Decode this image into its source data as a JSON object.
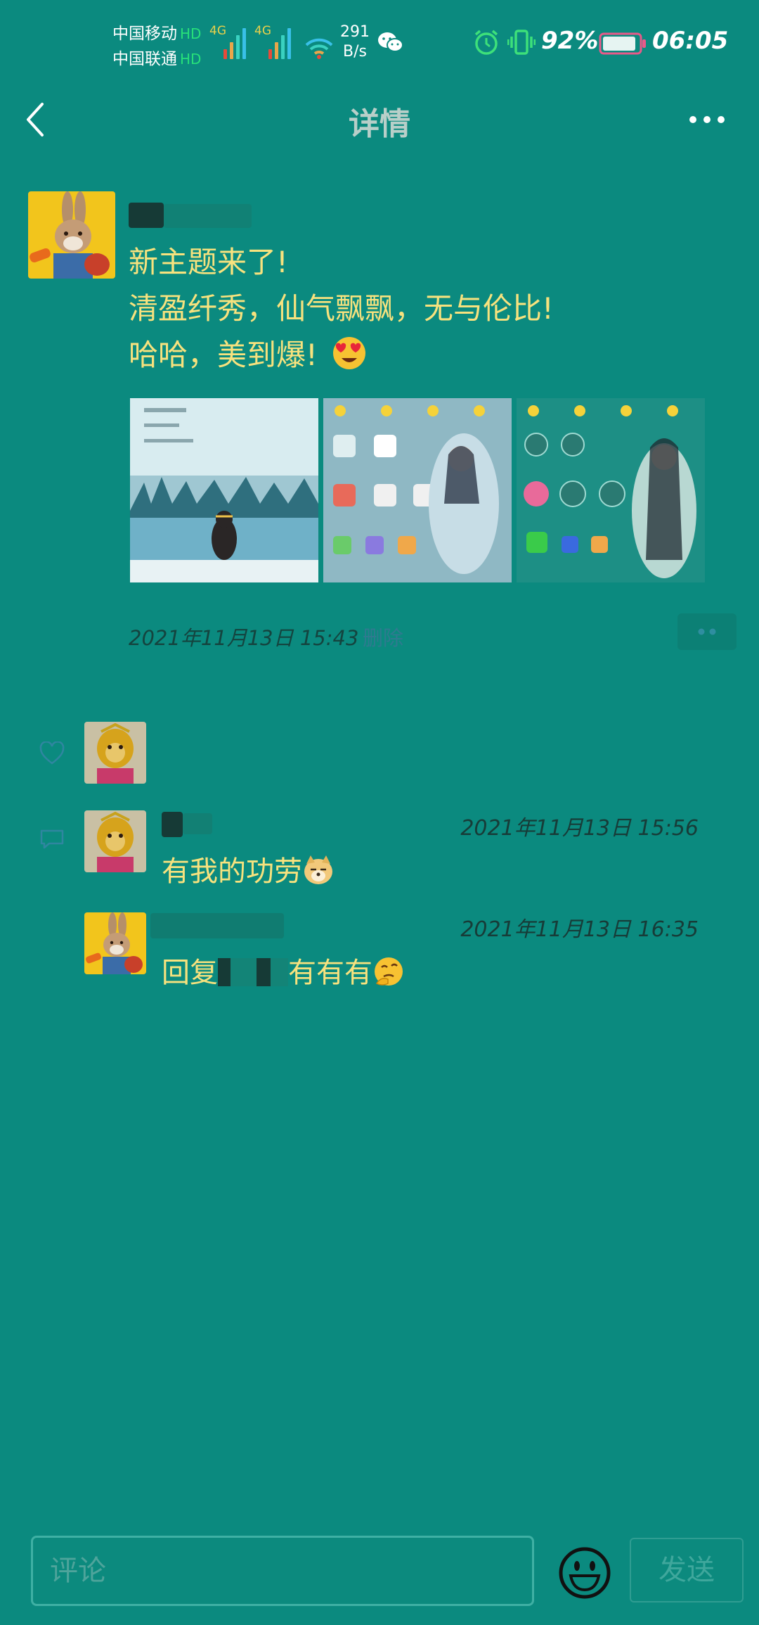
{
  "status_bar": {
    "carrier1": "中国移动",
    "carrier2": "中国联通",
    "hd_label": "HD",
    "net_label": "4G",
    "speed_value": "291",
    "speed_unit": "B/s",
    "battery_percent": "92%",
    "battery_level": 0.92,
    "time": "06:05",
    "icons": [
      "wechat-icon",
      "alarm-icon",
      "vibrate-icon",
      "battery-icon",
      "wifi-icon"
    ]
  },
  "header": {
    "title": "详情",
    "back_icon": "chevron-left-icon",
    "more_icon": "more-dots-icon"
  },
  "post": {
    "lines": [
      "新主题来了!",
      "清盈纤秀，仙气飘飘，无与伦比!",
      "哈哈，美到爆!"
    ],
    "timestamp": "2021年11月13日 15:43",
    "delete_label": "删除",
    "images": [
      "theme-preview-lake",
      "theme-preview-fairy",
      "theme-preview-fairy-2"
    ]
  },
  "comments": [
    {
      "text": "有我的功劳",
      "time": "2021年11月13日 15:56"
    },
    {
      "text_prefix": "回复",
      "text_suffix": "有有有",
      "time": "2021年11月13日 16:35"
    }
  ],
  "input_bar": {
    "placeholder": "评论",
    "send_label": "发送"
  },
  "colors": {
    "background": "#0b8a7f",
    "post_text": "#f7e27e",
    "meta_text": "#173c38",
    "delete_link": "#2f7a90"
  }
}
